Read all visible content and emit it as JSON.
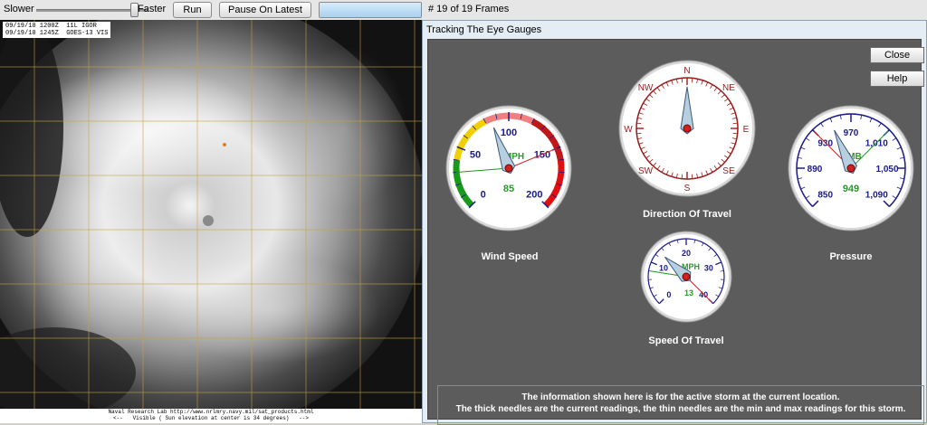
{
  "toolbar": {
    "slower_label": "Slower",
    "faster_label": "Faster",
    "run_label": "Run",
    "pause_label": "Pause On Latest",
    "frames_text": "# 19 of 19 Frames"
  },
  "satellite": {
    "info_line1": "09/19/10 1200Z  11L IGOR",
    "info_line2": "09/19/10 1245Z  GOES-13 VIS",
    "footer_line1": "Naval Research Lab http://www.nrlmry.navy.mil/sat_products.html",
    "footer_line2": "<--   Visible ( Sun elevation at center is 34 degrees)   -->"
  },
  "window": {
    "title": "Tracking The Eye Gauges",
    "close_label": "Close",
    "help_label": "Help",
    "info_line1": "The information shown here is for the active storm at the current location.",
    "info_line2": "The thick needles are the current readings, the thin needles are the min and max readings for this storm."
  },
  "gauges": {
    "wind": {
      "caption": "Wind Speed",
      "unit": "MPH",
      "reading": "85",
      "ticks": [
        "0",
        "50",
        "100",
        "150",
        "200"
      ],
      "current": 85,
      "min": 30,
      "max": 150
    },
    "direction": {
      "caption": "Direction Of Travel",
      "points": [
        "N",
        "NE",
        "E",
        "SE",
        "S",
        "SW",
        "W",
        "NW"
      ],
      "heading": 0
    },
    "pressure": {
      "caption": "Pressure",
      "unit": "MB",
      "reading": "949",
      "ticks": [
        "850",
        "890",
        "930",
        "970",
        "1,010",
        "1,050",
        "1,090"
      ],
      "current": 949,
      "min": 930,
      "max": 1010
    },
    "speed": {
      "caption": "Speed Of Travel",
      "unit": "MPH",
      "reading": "13",
      "ticks": [
        "0",
        "10",
        "20",
        "30",
        "40"
      ],
      "current": 13,
      "min": 8,
      "max": 40
    }
  },
  "colors": {
    "window_bg": "#5c5c5c",
    "needle": "#b8cfe0",
    "reading": "#2a9a2a",
    "ticks": "#1a1a8a"
  }
}
